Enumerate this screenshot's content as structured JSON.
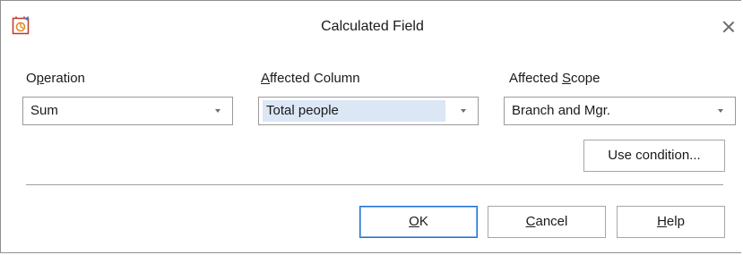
{
  "window": {
    "title": "Calculated Field",
    "app_icon": "calculated-field-app-icon",
    "close_icon": "close-icon"
  },
  "form": {
    "operation": {
      "label_pre": "O",
      "label_mnemonic": "p",
      "label_post": "eration",
      "value": "Sum"
    },
    "affected_column": {
      "label_pre": "",
      "label_mnemonic": "A",
      "label_post": "ffected Column",
      "value": "Total people"
    },
    "affected_scope": {
      "label_pre": "Affected ",
      "label_mnemonic": "S",
      "label_post": "cope",
      "value": "Branch and Mgr."
    }
  },
  "buttons": {
    "use_condition": "Use condition...",
    "ok": {
      "mnemonic": "O",
      "rest": "K"
    },
    "cancel": {
      "mnemonic": "C",
      "rest": "ancel"
    },
    "help": {
      "mnemonic": "H",
      "rest": "elp"
    }
  },
  "colors": {
    "selection": "#dbe7f5",
    "default_button_border": "#1e6fd0"
  }
}
